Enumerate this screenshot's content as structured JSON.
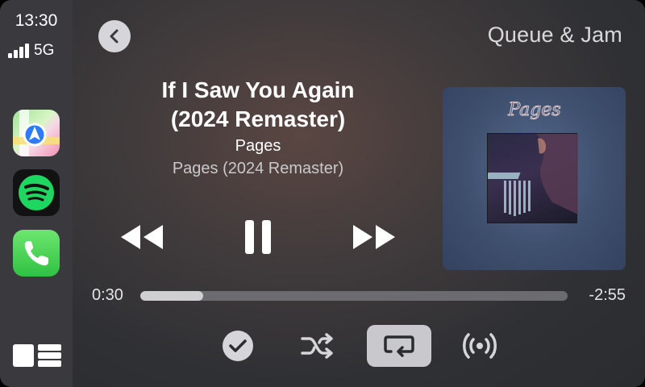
{
  "status": {
    "time": "13:30",
    "network": "5G"
  },
  "sidebar": {
    "apps": [
      {
        "name": "Maps",
        "icon": "maps-icon"
      },
      {
        "name": "Spotify",
        "icon": "spotify-icon"
      },
      {
        "name": "Phone",
        "icon": "phone-icon"
      }
    ],
    "dashboard_icon": "dashboard-icon"
  },
  "header": {
    "queue_label": "Queue & Jam"
  },
  "track": {
    "title_line1": "If I Saw You Again",
    "title_line2": "(2024 Remaster)",
    "artist": "Pages",
    "album": "Pages (2024 Remaster)"
  },
  "album_art": {
    "logo_text": "Pages"
  },
  "playback": {
    "elapsed": "0:30",
    "remaining": "-2:55",
    "progress_fraction": 0.148,
    "state": "playing"
  },
  "actions": {
    "saved": true,
    "shuffle": false,
    "repeat": true
  },
  "colors": {
    "accent": "#c9c9cd",
    "spotify_green": "#1ed760",
    "background": "#2b2c30"
  }
}
